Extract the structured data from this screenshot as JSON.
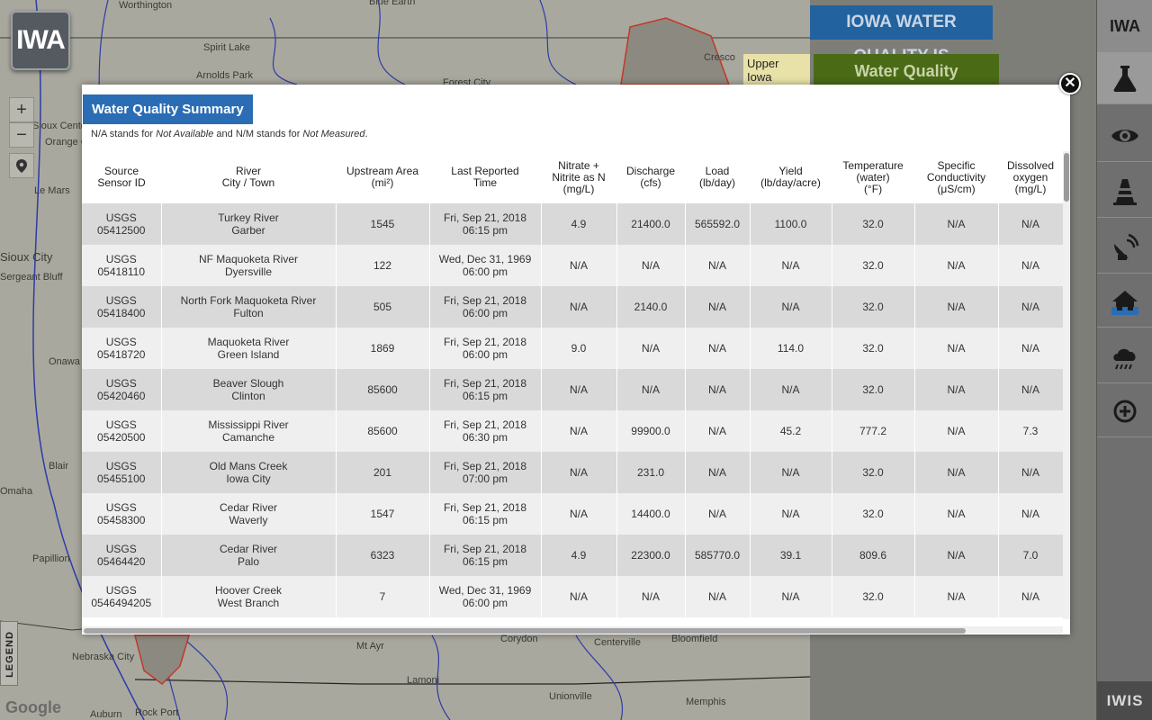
{
  "app": {
    "logo_text": "IWA",
    "title_badge": "IOWA WATER QUALITY IS",
    "conditions_badge": "Water Quality Conditions",
    "rail_logo": "IWA",
    "rail_bottom": "IWIS",
    "legend_label": "LEGEND",
    "google_label": "Google",
    "map_tooltip": "Upper Iowa"
  },
  "map": {
    "labels": [
      "Worthington",
      "Blue Earth",
      "Spirit Lake",
      "Arnolds Park",
      "Forest City",
      "Cresco",
      "Sioux Center",
      "Orange City",
      "Le Mars",
      "Sioux City",
      "Sergeant Bluff",
      "Onawa",
      "Blair",
      "Omaha",
      "Papillion",
      "Nebraska City",
      "Auburn",
      "Rock Port",
      "Centerville",
      "Bloomfield",
      "Mt Ayr",
      "Lamoni",
      "Corydon",
      "Unionville",
      "Memphis"
    ],
    "icons": [
      "zoom-in-icon",
      "zoom-out-icon",
      "location-pin-icon"
    ]
  },
  "rail": {
    "items": [
      "flask-icon",
      "eye-icon",
      "traffic-cone-icon",
      "satellite-dish-icon",
      "flooded-house-icon",
      "rain-cloud-icon",
      "add-circle-icon"
    ]
  },
  "modal": {
    "title": "Water Quality Summary",
    "note_prefix": "N/A stands for ",
    "note_na": "Not Available",
    "note_mid": " and N/M stands for ",
    "note_nm": "Not Measured",
    "note_suffix": ".",
    "close_label": "✕",
    "columns": [
      "Source\nSensor ID",
      "River\nCity / Town",
      "Upstream Area\n(mi²)",
      "Last Reported\nTime",
      "Nitrate +\nNitrite as N\n(mg/L)",
      "Discharge\n(cfs)",
      "Load\n(lb/day)",
      "Yield\n(lb/day/acre)",
      "Temperature\n(water)\n(°F)",
      "Specific\nConductivity\n(μS/cm)",
      "Dissolved\noxygen\n(mg/L)"
    ],
    "rows": [
      [
        "USGS\n05412500",
        "Turkey River\nGarber",
        "1545",
        "Fri, Sep 21, 2018\n06:15 pm",
        "4.9",
        "21400.0",
        "565592.0",
        "1100.0",
        "32.0",
        "N/A",
        "N/A"
      ],
      [
        "USGS\n05418110",
        "NF Maquoketa River\nDyersville",
        "122",
        "Wed, Dec 31, 1969\n06:00 pm",
        "N/A",
        "N/A",
        "N/A",
        "N/A",
        "32.0",
        "N/A",
        "N/A"
      ],
      [
        "USGS\n05418400",
        "North Fork Maquoketa River\nFulton",
        "505",
        "Fri, Sep 21, 2018\n06:00 pm",
        "N/A",
        "2140.0",
        "N/A",
        "N/A",
        "32.0",
        "N/A",
        "N/A"
      ],
      [
        "USGS\n05418720",
        "Maquoketa River\nGreen Island",
        "1869",
        "Fri, Sep 21, 2018\n06:00 pm",
        "9.0",
        "N/A",
        "N/A",
        "114.0",
        "32.0",
        "N/A",
        "N/A"
      ],
      [
        "USGS\n05420460",
        "Beaver Slough\nClinton",
        "85600",
        "Fri, Sep 21, 2018\n06:15 pm",
        "N/A",
        "N/A",
        "N/A",
        "N/A",
        "32.0",
        "N/A",
        "N/A"
      ],
      [
        "USGS\n05420500",
        "Mississippi River\nCamanche",
        "85600",
        "Fri, Sep 21, 2018\n06:30 pm",
        "N/A",
        "99900.0",
        "N/A",
        "45.2",
        "777.2",
        "N/A",
        "7.3"
      ],
      [
        "USGS\n05455100",
        "Old Mans Creek\nIowa City",
        "201",
        "Fri, Sep 21, 2018\n07:00 pm",
        "N/A",
        "231.0",
        "N/A",
        "N/A",
        "32.0",
        "N/A",
        "N/A"
      ],
      [
        "USGS\n05458300",
        "Cedar River\nWaverly",
        "1547",
        "Fri, Sep 21, 2018\n06:15 pm",
        "N/A",
        "14400.0",
        "N/A",
        "N/A",
        "32.0",
        "N/A",
        "N/A"
      ],
      [
        "USGS\n05464420",
        "Cedar River\nPalo",
        "6323",
        "Fri, Sep 21, 2018\n06:15 pm",
        "4.9",
        "22300.0",
        "585770.0",
        "39.1",
        "809.6",
        "N/A",
        "7.0"
      ],
      [
        "USGS\n0546494205",
        "Hoover Creek\nWest Branch",
        "7",
        "Wed, Dec 31, 1969\n06:00 pm",
        "N/A",
        "N/A",
        "N/A",
        "N/A",
        "32.0",
        "N/A",
        "N/A"
      ]
    ]
  },
  "colors": {
    "title_badge": "#22629e",
    "conditions_badge": "#4a6a16",
    "modal_title": "#2a6db5",
    "row_odd": "#d9d9d9",
    "row_even": "#efefef",
    "river": "#2c3ca8"
  }
}
